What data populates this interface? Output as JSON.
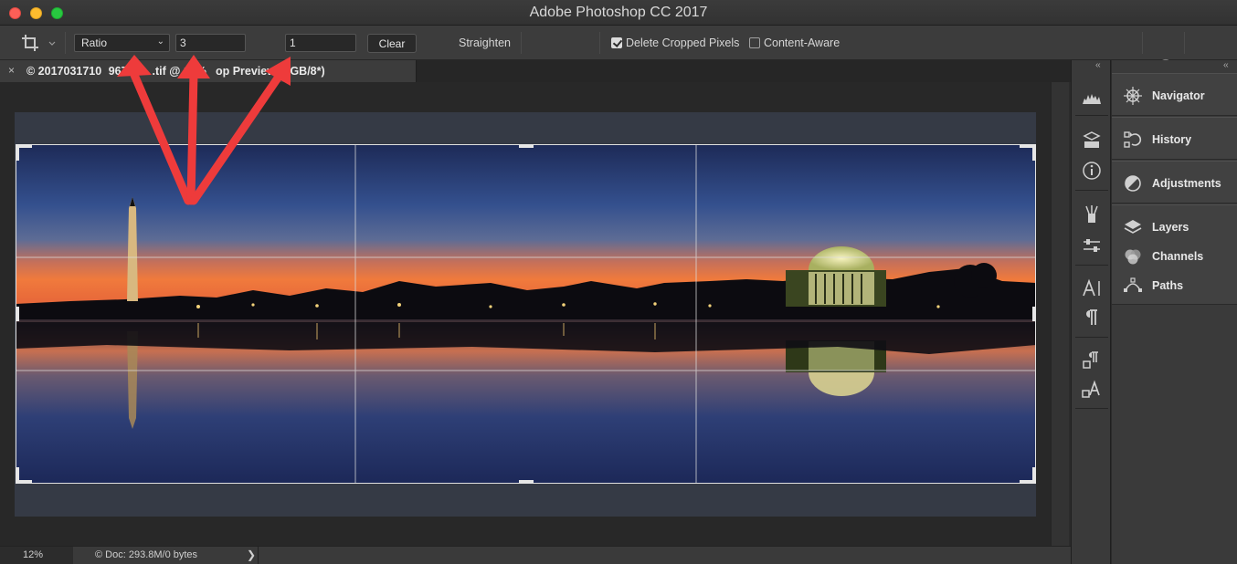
{
  "window": {
    "title": "Adobe Photoshop CC 2017"
  },
  "options_bar": {
    "ratio_preset": "Ratio",
    "width_value": "3",
    "height_value": "1",
    "clear_label": "Clear",
    "straighten_label": "Straighten",
    "delete_cropped_label": "Delete Cropped Pixels",
    "delete_cropped_checked": true,
    "content_aware_label": "Content-Aware",
    "content_aware_checked": false
  },
  "document": {
    "tab_title": "© 2017031710   967-Pa   .tif @ 12%    op Preview, RGB/8*)",
    "close_glyph": "×"
  },
  "status_bar": {
    "zoom": "12%",
    "doc_info": "© Doc: 293.8M/0 bytes",
    "arrow": "❯"
  },
  "icon_column": {
    "collapse": "‹‹",
    "icons": [
      "histogram-icon",
      "3d-icon",
      "info-icon",
      "brush-icon",
      "properties-icon",
      "character-icon",
      "paragraph-icon",
      "paragraph-styles-icon",
      "character-styles-icon"
    ]
  },
  "panels": {
    "collapse": "‹‹",
    "items": [
      {
        "label": "Navigator",
        "icon": "navigator-icon"
      },
      {
        "label": "History",
        "icon": "history-icon"
      },
      {
        "label": "Adjustments",
        "icon": "adjustments-icon"
      },
      {
        "label": "Layers",
        "icon": "layers-icon"
      },
      {
        "label": "Channels",
        "icon": "channels-icon"
      },
      {
        "label": "Paths",
        "icon": "paths-icon"
      }
    ]
  },
  "colors": {
    "accent_arrows": "#f03a3a",
    "sky_top": "#1e2d5a",
    "sunset": "#e8703a"
  }
}
